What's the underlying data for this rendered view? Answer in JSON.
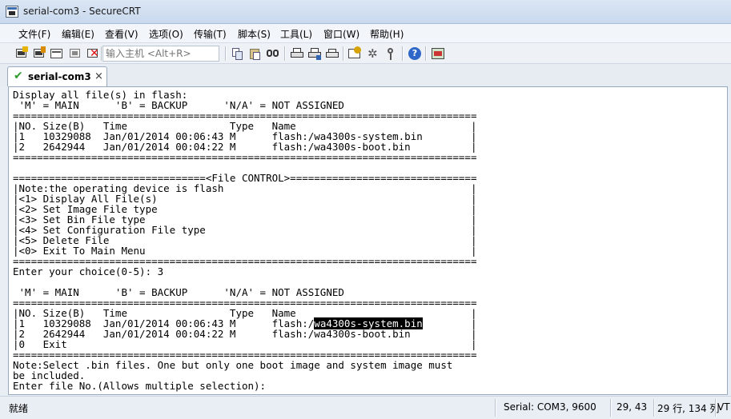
{
  "window": {
    "title": "serial-com3 - SecureCRT"
  },
  "menu": {
    "items": [
      "文件(F)",
      "编辑(E)",
      "查看(V)",
      "选项(O)",
      "传输(T)",
      "脚本(S)",
      "工具(L)",
      "窗口(W)",
      "帮助(H)"
    ]
  },
  "toolbar": {
    "host_placeholder": "输入主机 <Alt+R>"
  },
  "tab": {
    "label": "serial-com3",
    "close": "×"
  },
  "terminal": {
    "lines": [
      "Display all file(s) in flash:",
      " 'M' = MAIN      'B' = BACKUP      'N/A' = NOT ASSIGNED",
      "=============================================================================",
      "|NO. Size(B)   Time                 Type   Name                             |",
      "|1   10329088  Jan/01/2014 00:06:43 M      flash:/wa4300s-system.bin        |",
      "|2   2642944   Jan/01/2014 00:04:22 M      flash:/wa4300s-boot.bin          |",
      "=============================================================================",
      "",
      "================================<File CONTROL>===============================",
      "|Note:the operating device is flash                                         |",
      "|<1> Display All File(s)                                                    |",
      "|<2> Set Image File type                                                    |",
      "|<3> Set Bin File type                                                      |",
      "|<4> Set Configuration File type                                            |",
      "|<5> Delete File                                                            |",
      "|<0> Exit To Main Menu                                                      |",
      "=============================================================================",
      "Enter your choice(0-5): 3",
      "",
      " 'M' = MAIN      'B' = BACKUP      'N/A' = NOT ASSIGNED",
      "=============================================================================",
      "|NO. Size(B)   Time                 Type   Name                             |",
      "|1   10329088  Jan/01/2014 00:06:43 M      flash:/",
      "|2   2642944   Jan/01/2014 00:04:22 M      flash:/wa4300s-boot.bin          |",
      "|0   Exit                                                                   |",
      "=============================================================================",
      "Note:Select .bin files. One but only one boot image and system image must",
      "be included.",
      "Enter file No.(Allows multiple selection):"
    ],
    "highlight_line_index": 22,
    "highlight_text": "wa4300s-system.bin",
    "highlight_suffix": "        |"
  },
  "status": {
    "ready": "就绪",
    "connection": "Serial: COM3, 9600",
    "cursor": "29,  43",
    "size": "29 行, 134 列",
    "term_type": "VT"
  }
}
